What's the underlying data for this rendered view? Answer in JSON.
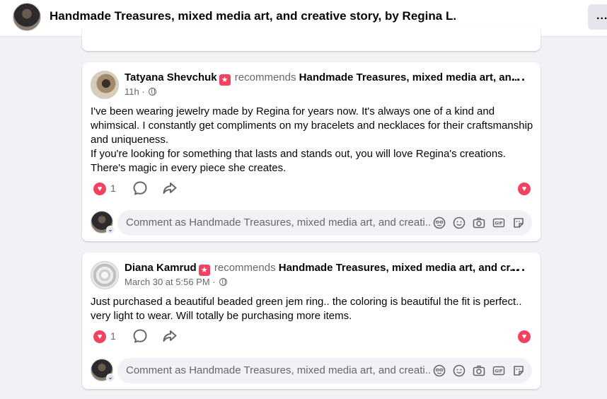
{
  "header": {
    "title": "Handmade Treasures, mixed media art, and creative story, by Regina L.",
    "more_label": "..."
  },
  "posts": [
    {
      "author": "Tatyana Shevchuk",
      "recommends": "recommends",
      "page": "Handmade Treasures, mixed media art, an...",
      "time": "11h",
      "separator": "·",
      "paragraphs": [
        "I've been wearing jewelry made by Regina for years now. It's always one of a kind and whimsical. I constantly get compliments on my bracelets and necklaces for their craftsmanship and uniqueness.",
        "If you're looking for something that lasts and stands out, you will love Regina's creations. There's magic in every piece she creates."
      ],
      "reaction_count": "1",
      "comment_placeholder": "Comment as Handmade Treasures, mixed media art, and creati..."
    },
    {
      "author": "Diana Kamrud",
      "recommends": "recommends",
      "page": "Handmade Treasures, mixed media art, and cr...",
      "time": "March 30 at 5:56 PM",
      "separator": "·",
      "paragraphs": [
        "Just purchased a beautiful beaded green jem ring.. the coloring is beautiful the fit is perfect.. very light to wear. Will totally be purchasing more items."
      ],
      "reaction_count": "1",
      "comment_placeholder": "Comment as Handmade Treasures, mixed media art, and creati..."
    }
  ],
  "icons": {
    "recommend": "recommend-badge-icon",
    "love": "love-reaction-icon",
    "comment": "comment-icon",
    "share": "share-icon",
    "avatar_switch": "chevron-down-icon",
    "sticker_avatar": "avatar-sticker-icon",
    "emoji": "emoji-icon",
    "camera": "camera-icon",
    "gif": "gif-icon",
    "sticker": "sticker-icon"
  },
  "colors": {
    "love": "#f3425f",
    "background": "#f0f2f5",
    "secondary_text": "#65676b"
  }
}
